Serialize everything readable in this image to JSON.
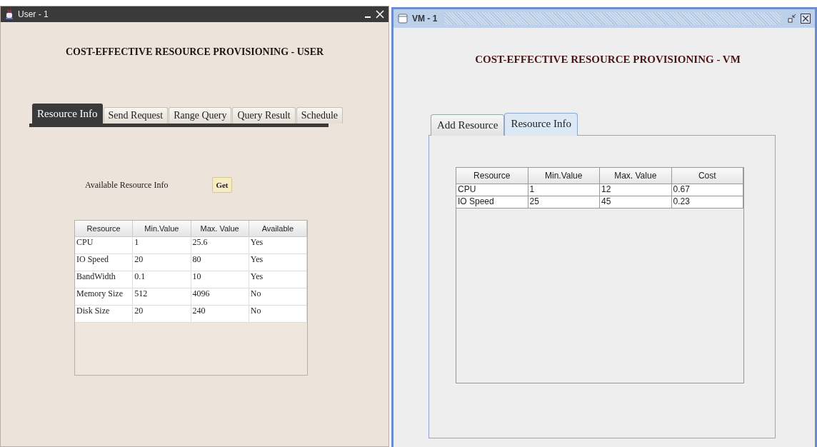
{
  "windows": [
    {
      "kind": "textured",
      "title": "User - 1",
      "heading": "COST-EFFECTIVE RESOURCE PROVISIONING - USER",
      "tabs": [
        {
          "label": "Resource Info",
          "selected": true
        },
        {
          "label": "Send Request",
          "selected": false
        },
        {
          "label": "Range Query",
          "selected": false
        },
        {
          "label": "Query Result",
          "selected": false
        },
        {
          "label": "Schedule",
          "selected": false
        }
      ],
      "label": "Available Resource Info",
      "button": "Get",
      "table": {
        "columns": [
          "Resource",
          "Min.Value",
          "Max. Value",
          "Available"
        ],
        "rows": [
          [
            "CPU",
            "1",
            "25.6",
            "Yes"
          ],
          [
            "IO Speed",
            "20",
            "80",
            "Yes"
          ],
          [
            "BandWidth",
            "0.1",
            "10",
            "Yes"
          ],
          [
            "Memory Size",
            "512",
            "4096",
            "No"
          ],
          [
            "Disk Size",
            "20",
            "240",
            "No"
          ]
        ]
      }
    },
    {
      "kind": "metal",
      "title": "VM - 1",
      "heading": "COST-EFFECTIVE RESOURCE PROVISIONING - VM",
      "tabs": [
        {
          "label": "Add Resource",
          "selected": false
        },
        {
          "label": "Resource Info",
          "selected": true
        }
      ],
      "table": {
        "columns": [
          "Resource",
          "Min.Value",
          "Max. Value",
          "Cost"
        ],
        "rows": [
          [
            "CPU",
            "1",
            "12",
            "0.67"
          ],
          [
            "IO Speed",
            "25",
            "45",
            "0.23"
          ]
        ]
      }
    }
  ]
}
